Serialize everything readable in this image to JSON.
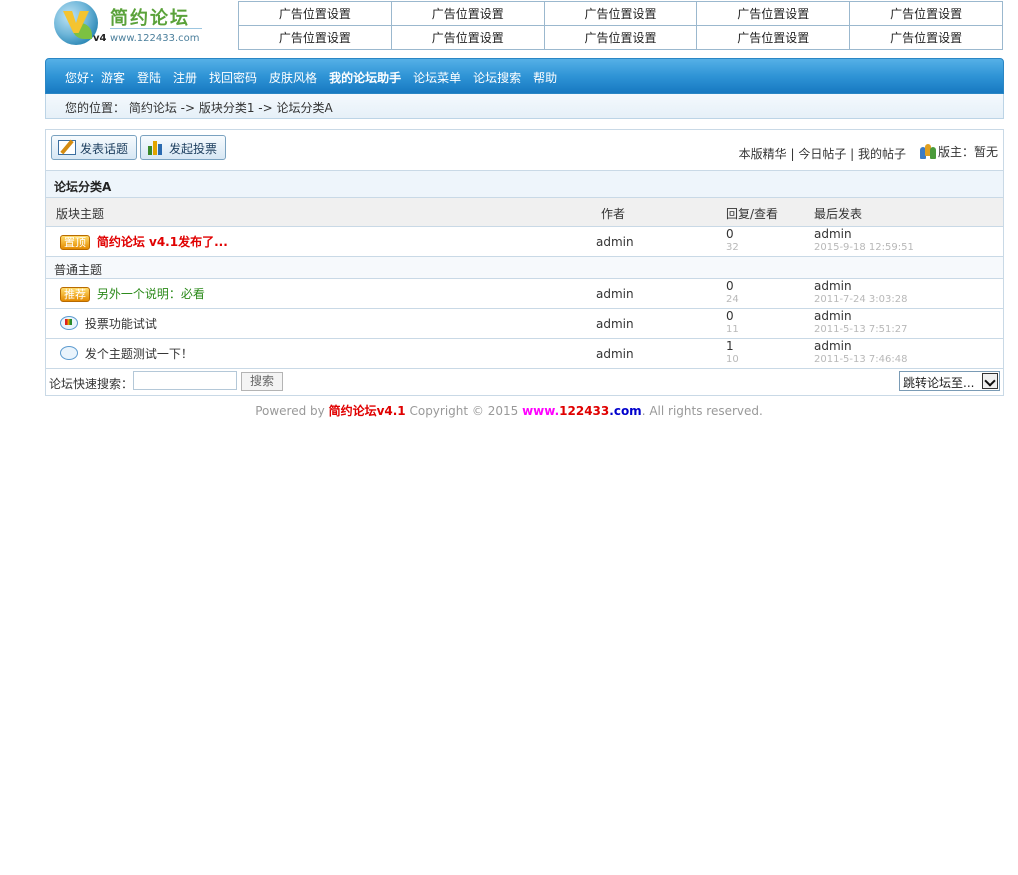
{
  "logo": {
    "title": "简约论坛",
    "version": "v4",
    "url": "www.122433.com"
  },
  "ads": [
    [
      "广告位置设置",
      "广告位置设置",
      "广告位置设置",
      "广告位置设置",
      "广告位置设置"
    ],
    [
      "广告位置设置",
      "广告位置设置",
      "广告位置设置",
      "广告位置设置",
      "广告位置设置"
    ]
  ],
  "nav": {
    "greeting": "您好：游客",
    "items": [
      "登陆",
      "注册",
      "找回密码",
      "皮肤风格",
      "我的论坛助手",
      "论坛菜单",
      "论坛搜索",
      "帮助"
    ]
  },
  "breadcrumb": "您的位置： 简约论坛 -> 版块分类1 -> 论坛分类A",
  "toolbar": {
    "post_label": "发表话题",
    "vote_label": "发起投票",
    "links": "本版精华 | 今日帖子 | 我的帖子",
    "moderator": "版主：暂无"
  },
  "forum": {
    "title": "论坛分类A",
    "columns": {
      "topic": "版块主题",
      "author": "作者",
      "replies": "回复/查看",
      "last": "最后发表"
    },
    "pinned": {
      "badge": "置顶",
      "title": "简约论坛 v4.1发布了...",
      "author": "admin",
      "replies": "0",
      "views": "32",
      "last_user": "admin",
      "last_time": "2015-9-18 12:59:51"
    },
    "section_label": "普通主题",
    "topics": [
      {
        "badge": "推荐",
        "title": "另外一个说明：必看",
        "author": "admin",
        "replies": "0",
        "views": "24",
        "last_user": "admin",
        "last_time": "2011-7-24 3:03:28"
      },
      {
        "badge": "",
        "title": "投票功能试试",
        "author": "admin",
        "replies": "0",
        "views": "11",
        "last_user": "admin",
        "last_time": "2011-5-13 7:51:27"
      },
      {
        "badge": "",
        "title": "发个主题测试一下！",
        "author": "admin",
        "replies": "1",
        "views": "10",
        "last_user": "admin",
        "last_time": "2011-5-13 7:46:48"
      }
    ]
  },
  "search": {
    "label": "论坛快速搜索：",
    "placeholder": "",
    "button": "搜索",
    "jump_label": "跳转论坛至..."
  },
  "footer": {
    "powered": "Powered by ",
    "brand": "简约论坛v4.1",
    "copyright": " Copyright © 2015 ",
    "www": "www.",
    "num": "122433",
    "com": ".com",
    "rights": ". All rights reserved."
  },
  "colors": {
    "nav_blue": "#2f94d6",
    "pinned_red": "#e00000",
    "recommend_green": "#2b8a1a"
  }
}
